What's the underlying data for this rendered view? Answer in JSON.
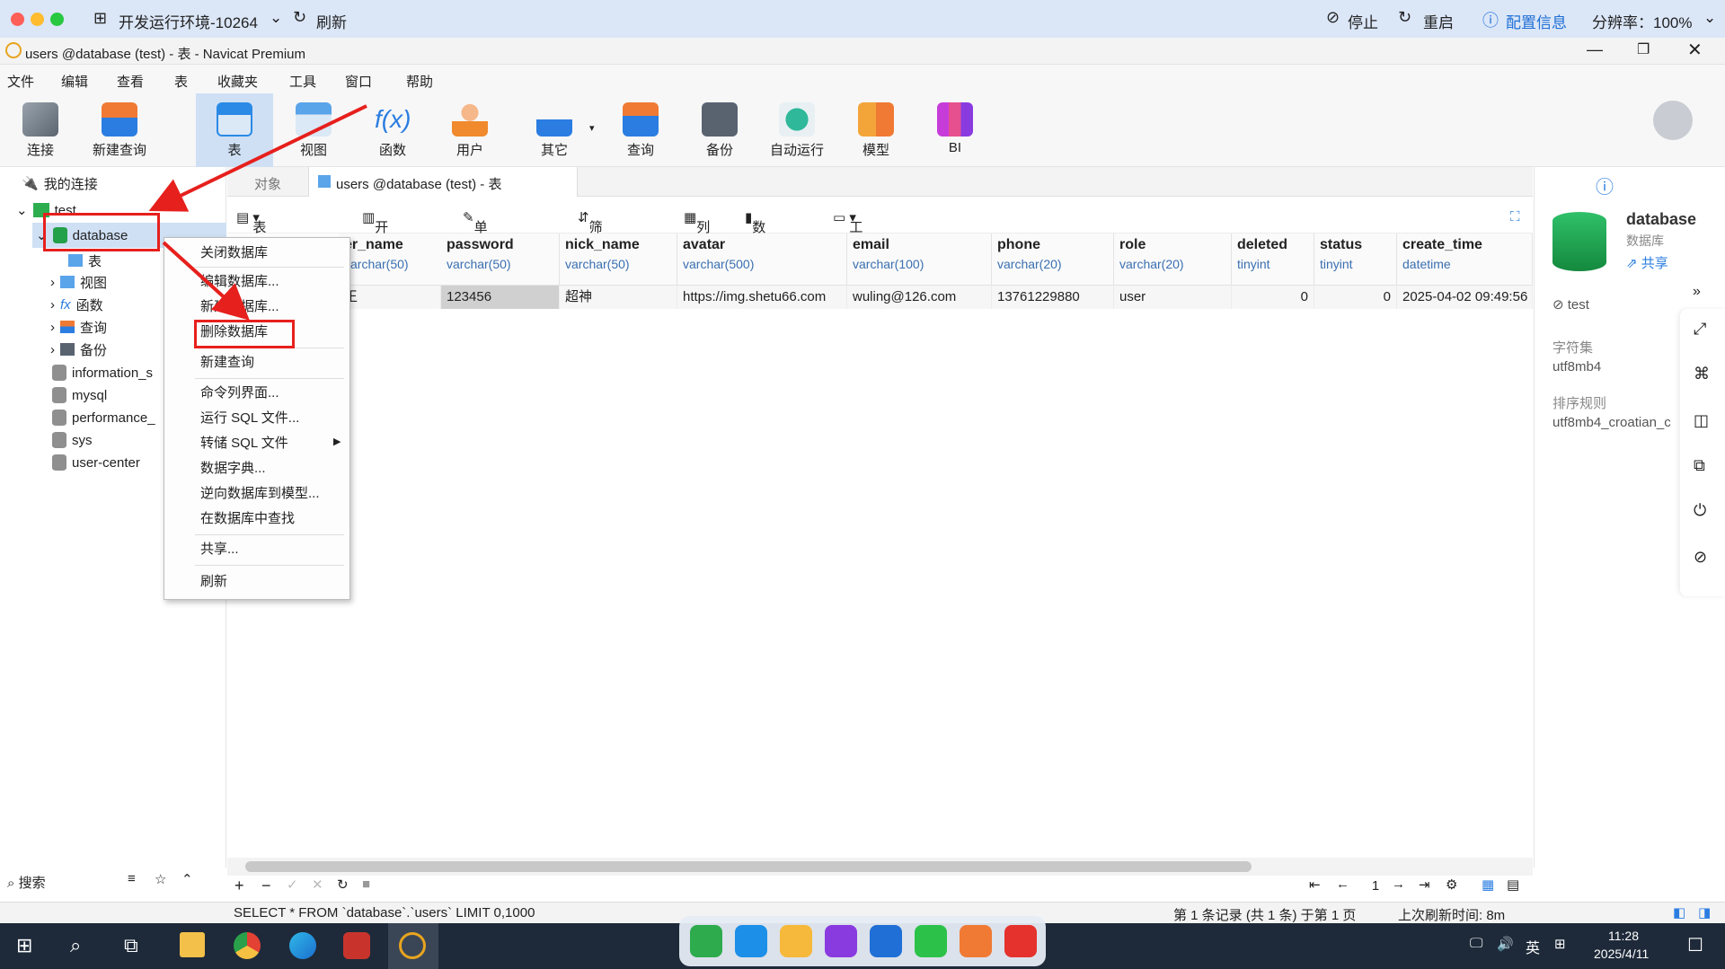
{
  "topbar": {
    "env": "开发运行环境-10264",
    "refresh": "刷新",
    "stop": "停止",
    "restart": "重启",
    "config": "配置信息",
    "resolution": "分辨率：100%"
  },
  "window": {
    "title": "users @database (test) - 表 - Navicat Premium"
  },
  "menu": [
    "文件",
    "编辑",
    "查看",
    "表",
    "收藏夹",
    "工具",
    "窗口",
    "帮助"
  ],
  "toolbar": [
    "连接",
    "新建查询",
    "表",
    "视图",
    "函数",
    "用户",
    "其它",
    "查询",
    "备份",
    "自动运行",
    "模型",
    "BI"
  ],
  "tree": {
    "root": "我的连接",
    "conn": "test",
    "db": "database",
    "children": [
      "表",
      "视图",
      "函数",
      "查询",
      "备份"
    ],
    "others": [
      "information_s",
      "mysql",
      "performance_",
      "sys",
      "user-center"
    ],
    "search": "搜索"
  },
  "tabs": {
    "objects": "对象",
    "current": "users @database (test) - 表"
  },
  "subtool": [
    "表配置文件",
    "开始事务",
    "单元格编辑器",
    "筛选 & 排序",
    "列",
    "数据分析",
    "工具"
  ],
  "grid": {
    "columns": [
      {
        "name": "er_name",
        "type": "varchar(50)"
      },
      {
        "name": "password",
        "type": "varchar(50)"
      },
      {
        "name": "nick_name",
        "type": "varchar(50)"
      },
      {
        "name": "avatar",
        "type": "varchar(500)"
      },
      {
        "name": "email",
        "type": "varchar(100)"
      },
      {
        "name": "phone",
        "type": "varchar(20)"
      },
      {
        "name": "role",
        "type": "varchar(20)"
      },
      {
        "name": "deleted",
        "type": "tinyint"
      },
      {
        "name": "status",
        "type": "tinyint"
      },
      {
        "name": "create_time",
        "type": "datetime"
      }
    ],
    "row": [
      "王",
      "123456",
      "超神",
      "https://img.shetu66.com",
      "wuling@126.com",
      "13761229880",
      "user",
      "0",
      "0",
      "2025-04-02 09:49:56"
    ]
  },
  "context_menu": [
    "关闭数据库",
    "编辑数据库...",
    "新建数据库...",
    "删除数据库",
    "新建查询",
    "命令列界面...",
    "运行 SQL 文件...",
    "转储 SQL 文件",
    "数据字典...",
    "逆向数据库到模型...",
    "在数据库中查找",
    "共享...",
    "刷新"
  ],
  "right_panel": {
    "name": "database",
    "kind": "数据库",
    "share": "共享",
    "conn": "test",
    "charset_label": "字符集",
    "charset": "utf8mb4",
    "collation_label": "排序规则",
    "collation": "utf8mb4_croatian_c"
  },
  "pager": {
    "page": "1"
  },
  "status": {
    "sql": "SELECT * FROM `database`.`users` LIMIT 0,1000",
    "records": "第 1 条记录 (共 1 条) 于第 1 页",
    "refresh": "上次刷新时间: 8m"
  },
  "taskbar": {
    "ime": "英",
    "time": "11:28",
    "date": "2025/4/11"
  },
  "colors": {
    "accent": "#1f6fd6",
    "annotation": "#e6201d"
  }
}
